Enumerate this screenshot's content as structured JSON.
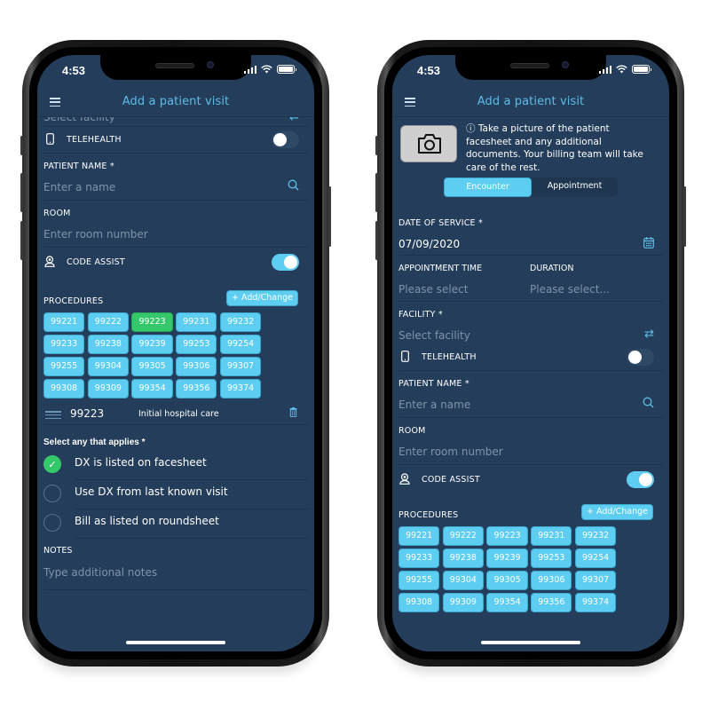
{
  "colors": {
    "screen_bg": "#243d5a",
    "accent": "#5dcdf2",
    "title": "#5dbde6",
    "selected": "#34c86a",
    "placeholder": "#7f94ab"
  },
  "status_bar": {
    "time": "4:53"
  },
  "left_phone": {
    "header": {
      "title": "Add a patient visit",
      "menu_icon": "hamburger-icon"
    },
    "facility": {
      "placeholder": "Select facility",
      "icon": "swap-icon"
    },
    "telehealth": {
      "label": "TELEHEALTH",
      "icon": "mobile-phone-icon",
      "on": false
    },
    "patient_name": {
      "label": "PATIENT NAME *",
      "placeholder": "Enter a name",
      "icon": "search-icon"
    },
    "room": {
      "label": "ROOM",
      "placeholder": "Enter room number"
    },
    "code_assist": {
      "label": "CODE ASSIST",
      "icon": "user-badge-icon",
      "on": true
    },
    "procedures": {
      "label": "PROCEDURES",
      "add_label": "+ Add/Change",
      "codes": [
        "99221",
        "99222",
        "99223",
        "99231",
        "99232",
        "99233",
        "99238",
        "99239",
        "99253",
        "99254",
        "99255",
        "99304",
        "99305",
        "99306",
        "99307",
        "99308",
        "99309",
        "99354",
        "99356",
        "99374"
      ],
      "selected": "99223"
    },
    "selected_procedure": {
      "code": "99223",
      "description": "Initial hospital care",
      "icon": "trash-icon"
    },
    "applies": {
      "label": "Select any that applies *",
      "options": [
        {
          "text": "DX is listed on facesheet",
          "checked": true
        },
        {
          "text": "Use DX from last known visit",
          "checked": false
        },
        {
          "text": "Bill as listed on roundsheet",
          "checked": false
        }
      ]
    },
    "notes": {
      "label": "NOTES",
      "placeholder": "Type additional notes"
    }
  },
  "right_phone": {
    "header": {
      "title": "Add a patient visit",
      "menu_icon": "hamburger-icon"
    },
    "photo": {
      "icon": "camera-icon",
      "info": "ⓘ Take a picture of the patient facesheet and any additional documents. Your billing team will take care of the rest."
    },
    "segment": {
      "tabs": [
        "Encounter",
        "Appointment"
      ],
      "active": "Encounter"
    },
    "date_of_service": {
      "label": "DATE OF SERVICE *",
      "value": "07/09/2020",
      "icon": "calendar-icon"
    },
    "appointment_time": {
      "label": "APPOINTMENT TIME",
      "placeholder": "Please select"
    },
    "duration": {
      "label": "DURATION",
      "placeholder": "Please select..."
    },
    "facility": {
      "label": "FACILITY *",
      "placeholder": "Select facility",
      "icon": "swap-icon"
    },
    "telehealth": {
      "label": "TELEHEALTH",
      "icon": "mobile-phone-icon",
      "on": false
    },
    "patient_name": {
      "label": "PATIENT NAME *",
      "placeholder": "Enter a name",
      "icon": "search-icon"
    },
    "room": {
      "label": "ROOM",
      "placeholder": "Enter room number"
    },
    "code_assist": {
      "label": "CODE ASSIST",
      "icon": "user-badge-icon",
      "on": true
    },
    "procedures": {
      "label": "PROCEDURES",
      "add_label": "+ Add/Change",
      "codes": [
        "99221",
        "99222",
        "99223",
        "99231",
        "99232",
        "99233",
        "99238",
        "99239",
        "99253",
        "99254",
        "99255",
        "99304",
        "99305",
        "99306",
        "99307",
        "99308",
        "99309",
        "99354",
        "99356",
        "99374"
      ],
      "selected": null
    }
  }
}
